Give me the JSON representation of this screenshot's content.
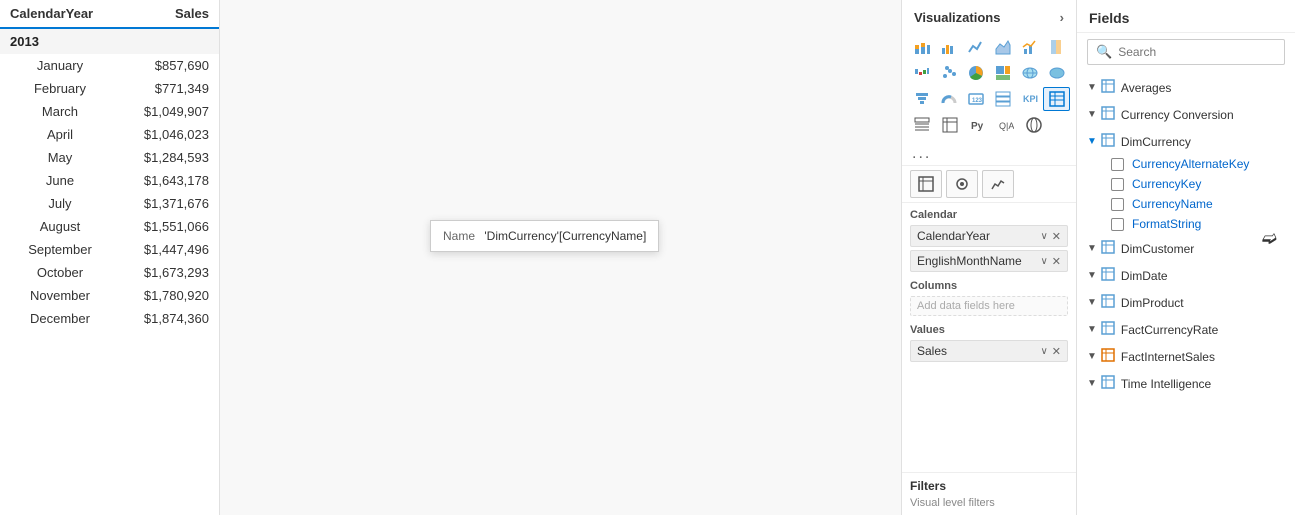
{
  "table": {
    "columns": [
      "CalendarYear",
      "Sales"
    ],
    "yearLabel": "2013",
    "rows": [
      {
        "month": "January",
        "sales": "$857,690"
      },
      {
        "month": "February",
        "sales": "$771,349"
      },
      {
        "month": "March",
        "sales": "$1,049,907"
      },
      {
        "month": "April",
        "sales": "$1,046,023"
      },
      {
        "month": "May",
        "sales": "$1,284,593"
      },
      {
        "month": "June",
        "sales": "$1,643,178"
      },
      {
        "month": "July",
        "sales": "$1,371,676"
      },
      {
        "month": "August",
        "sales": "$1,551,066"
      },
      {
        "month": "September",
        "sales": "$1,447,496"
      },
      {
        "month": "October",
        "sales": "$1,673,293"
      },
      {
        "month": "November",
        "sales": "$1,780,920"
      },
      {
        "month": "December",
        "sales": "$1,874,360"
      }
    ]
  },
  "tooltip": {
    "label": "Name",
    "value": "'DimCurrency'[CurrencyName]"
  },
  "visualizations": {
    "header": "Visualizations",
    "more_label": "...",
    "controls": [
      "grid-icon",
      "format-icon",
      "analytics-icon"
    ]
  },
  "field_wells": {
    "rows_label": "Calendar",
    "rows_fields": [
      "CalendarYear",
      "EnglishMonthName"
    ],
    "columns_label": "Columns",
    "columns_placeholder": "Add data fields here",
    "values_label": "Values",
    "values_fields": [
      "Sales"
    ],
    "filters_label": "Filters",
    "filters_sublabel": "Visual level filters"
  },
  "fields": {
    "header": "Fields",
    "search_placeholder": "Search",
    "groups": [
      {
        "name": "Averages",
        "icon": "table",
        "expanded": false,
        "items": []
      },
      {
        "name": "Currency Conversion",
        "icon": "table",
        "expanded": false,
        "items": []
      },
      {
        "name": "DimCurrency",
        "icon": "table",
        "expanded": true,
        "items": [
          {
            "name": "CurrencyAlternateKey",
            "checked": false
          },
          {
            "name": "CurrencyKey",
            "checked": false
          },
          {
            "name": "CurrencyName",
            "checked": false
          },
          {
            "name": "FormatString",
            "checked": false
          }
        ]
      },
      {
        "name": "DimCustomer",
        "icon": "table",
        "expanded": false,
        "items": []
      },
      {
        "name": "DimDate",
        "icon": "table",
        "expanded": false,
        "items": []
      },
      {
        "name": "DimProduct",
        "icon": "table",
        "expanded": false,
        "items": []
      },
      {
        "name": "FactCurrencyRate",
        "icon": "table",
        "expanded": false,
        "items": []
      },
      {
        "name": "FactInternetSales",
        "icon": "table-orange",
        "expanded": false,
        "items": []
      },
      {
        "name": "Time Intelligence",
        "icon": "table",
        "expanded": false,
        "items": []
      }
    ]
  }
}
